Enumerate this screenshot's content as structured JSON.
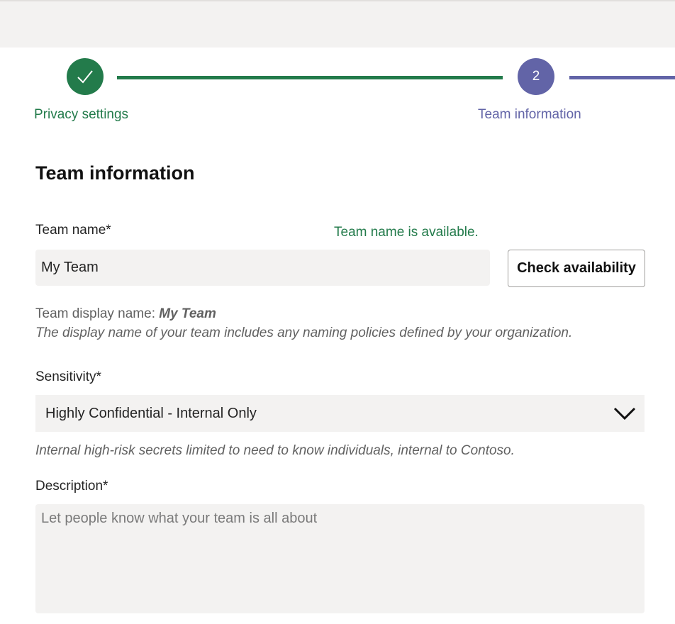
{
  "header": {},
  "stepper": {
    "steps": [
      {
        "label": "Privacy settings",
        "status": "completed",
        "icon": "check-icon"
      },
      {
        "label": "Team information",
        "status": "current",
        "number": "2"
      }
    ],
    "colors": {
      "completed": "#237b4b",
      "current": "#6264a7"
    }
  },
  "form": {
    "title": "Team information",
    "team_name": {
      "label": "Team name*",
      "value": "My Team",
      "availability_message": "Team name is available.",
      "check_button_label": "Check availability"
    },
    "display_name": {
      "prefix": "Team display name:",
      "value": "My Team",
      "helper": "The display name of your team includes any naming policies defined by your organization."
    },
    "sensitivity": {
      "label": "Sensitivity*",
      "selected": "Highly Confidential - Internal Only",
      "helper": "Internal high-risk secrets limited to need to know individuals, internal to Contoso."
    },
    "description": {
      "label": "Description*",
      "placeholder": "Let people know what your team is all about",
      "value": ""
    }
  }
}
